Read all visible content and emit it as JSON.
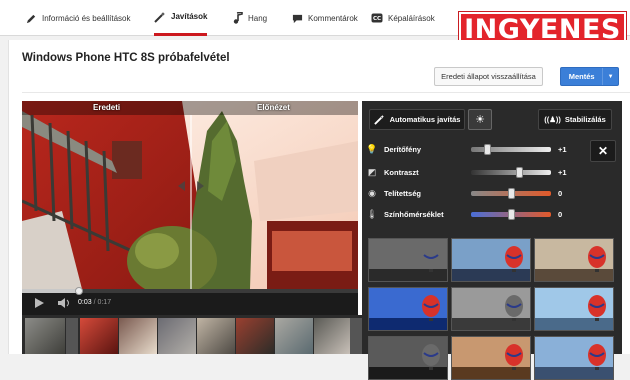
{
  "tabs": [
    {
      "label": "Információ és beállítások",
      "icon": "pencil-icon",
      "active": false
    },
    {
      "label": "Javítások",
      "icon": "magic-wand-icon",
      "active": true
    },
    {
      "label": "Hang",
      "icon": "music-note-icon",
      "active": false
    },
    {
      "label": "Kommentárok",
      "icon": "speech-bubble-icon",
      "active": false
    },
    {
      "label": "Képaláírások",
      "icon": "cc-icon",
      "active": false
    }
  ],
  "overlay_badge": "INGYENES",
  "page_title": "Windows Phone HTC 8S próbafelvétel",
  "revert_label": "Eredeti állapot visszaállítása",
  "save_label": "Mentés",
  "video": {
    "original_label": "Eredeti",
    "preview_label": "Előnézet",
    "time_current": "0:03",
    "time_total": "/ 0:17",
    "progress": 0.17
  },
  "effects": {
    "auto_fix_label": "Automatikus javítás",
    "stabilize_label": "Stabilizálás",
    "adjustments": [
      {
        "label": "Derítőfény",
        "value": "+1",
        "icon": "bulb-icon",
        "level": 0.2
      },
      {
        "label": "Kontraszt",
        "value": "+1",
        "icon": "contrast-icon",
        "level": 0.6
      },
      {
        "label": "Telítettség",
        "value": "0",
        "icon": "saturation-icon",
        "level": 0.5
      },
      {
        "label": "Színhőmérséklet",
        "value": "0",
        "icon": "thermometer-icon",
        "level": 0.5
      }
    ]
  },
  "colors": {
    "accent_red": "#cc181e",
    "save_blue": "#3b7fd8",
    "badge_red": "#e3242b"
  }
}
